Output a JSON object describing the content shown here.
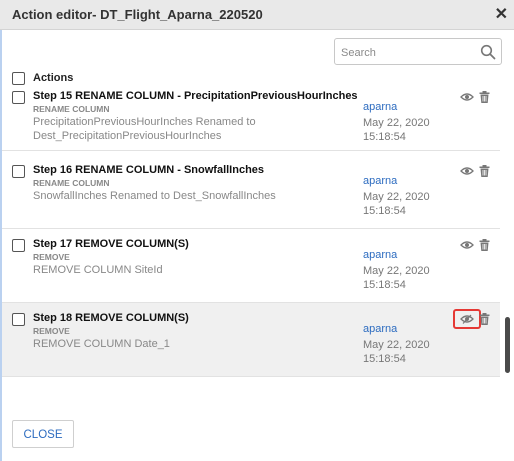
{
  "dialog": {
    "title": "Action editor- DT_Flight_Aparna_220520",
    "close_symbol": "✕"
  },
  "search": {
    "placeholder": "Search",
    "value": ""
  },
  "list_header": {
    "label": "Actions"
  },
  "actions": [
    {
      "title": "Step 15 RENAME COLUMN - PrecipitationPreviousHourInches",
      "operation": "RENAME COLUMN",
      "description": [
        "PrecipitationPreviousHourInches Renamed to",
        "Dest_PrecipitationPreviousHourInches"
      ],
      "user": "aparna",
      "date": "May 22, 2020",
      "time": "15:18:54",
      "selected": false
    },
    {
      "title": "Step 16 RENAME COLUMN - SnowfallInches",
      "operation": "RENAME COLUMN",
      "description": [
        "SnowfallInches Renamed to Dest_SnowfallInches"
      ],
      "user": "aparna",
      "date": "May 22, 2020",
      "time": "15:18:54",
      "selected": false
    },
    {
      "title": "Step 17 REMOVE COLUMN(S)",
      "operation": "REMOVE",
      "description": [
        "REMOVE COLUMN SiteId"
      ],
      "user": "aparna",
      "date": "May 22, 2020",
      "time": "15:18:54",
      "selected": false
    },
    {
      "title": "Step 18 REMOVE COLUMN(S)",
      "operation": "REMOVE",
      "description": [
        "REMOVE COLUMN Date_1"
      ],
      "user": "aparna",
      "date": "May 22, 2020",
      "time": "15:18:54",
      "selected": true,
      "eye_highlighted": true
    }
  ],
  "footer": {
    "close_label": "CLOSE"
  },
  "colors": {
    "user": "#2d6cc0",
    "highlight": "#e53935",
    "selected_row": "#f0f0f0"
  },
  "icons": {
    "search": "search-icon",
    "view": "eye-icon",
    "delete": "trash-icon",
    "close": "close-icon"
  }
}
